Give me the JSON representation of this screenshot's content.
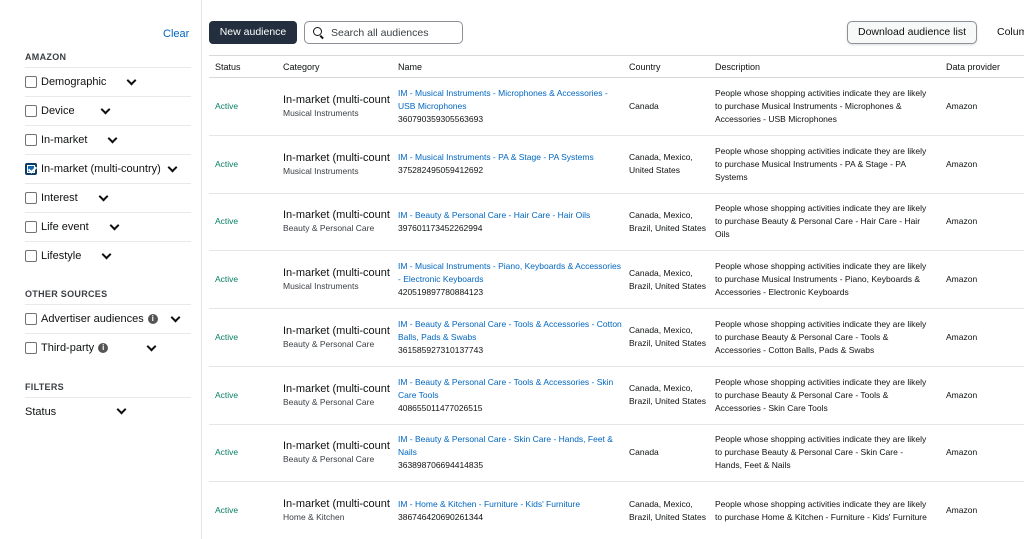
{
  "sidebar": {
    "clear_label": "Clear",
    "amazon_title": "AMAZON",
    "amazon_items": [
      {
        "label": "Demographic",
        "checked": false
      },
      {
        "label": "Device",
        "checked": false
      },
      {
        "label": "In-market",
        "checked": false
      },
      {
        "label": "In-market (multi-country)",
        "checked": true
      },
      {
        "label": "Interest",
        "checked": false
      },
      {
        "label": "Life event",
        "checked": false
      },
      {
        "label": "Lifestyle",
        "checked": false
      }
    ],
    "other_title": "OTHER SOURCES",
    "other_items": [
      {
        "label": "Advertiser audiences",
        "checked": false
      },
      {
        "label": "Third-party",
        "checked": false
      }
    ],
    "filters_title": "FILTERS",
    "status_label": "Status"
  },
  "toolbar": {
    "new_audience_label": "New audience",
    "search_placeholder": "Search all audiences",
    "download_label": "Download audience list",
    "columns_label": "Colum"
  },
  "table": {
    "headers": {
      "status": "Status",
      "category": "Category",
      "name": "Name",
      "country": "Country",
      "description": "Description",
      "provider": "Data provider"
    },
    "rows": [
      {
        "status": "Active",
        "category": "In-market (multi-count",
        "subcategory": "Musical Instruments",
        "name": "IM - Musical Instruments - Microphones & Accessories - USB Microphones",
        "id": "360790359305563693",
        "country": "Canada",
        "description": "People whose shopping activities indicate they are likely to purchase Musical Instruments - Microphones & Accessories - USB Microphones",
        "provider": "Amazon"
      },
      {
        "status": "Active",
        "category": "In-market (multi-count",
        "subcategory": "Musical Instruments",
        "name": "IM - Musical Instruments - PA & Stage - PA Systems",
        "id": "375282495059412692",
        "country": "Canada, Mexico, United States",
        "description": "People whose shopping activities indicate they are likely to purchase Musical Instruments - PA & Stage - PA Systems",
        "provider": "Amazon"
      },
      {
        "status": "Active",
        "category": "In-market (multi-count",
        "subcategory": "Beauty & Personal Care",
        "name": "IM - Beauty & Personal Care - Hair Care - Hair Oils",
        "id": "397601173452262994",
        "country": "Canada, Mexico, Brazil, United States",
        "description": "People whose shopping activities indicate they are likely to purchase Beauty & Personal Care - Hair Care - Hair Oils",
        "provider": "Amazon"
      },
      {
        "status": "Active",
        "category": "In-market (multi-count",
        "subcategory": "Musical Instruments",
        "name": "IM - Musical Instruments - Piano, Keyboards & Accessories - Electronic Keyboards",
        "id": "420519897780884123",
        "country": "Canada, Mexico, Brazil, United States",
        "description": "People whose shopping activities indicate they are likely to purchase Musical Instruments - Piano, Keyboards & Accessories - Electronic Keyboards",
        "provider": "Amazon"
      },
      {
        "status": "Active",
        "category": "In-market (multi-count",
        "subcategory": "Beauty & Personal Care",
        "name": "IM - Beauty & Personal Care - Tools & Accessories - Cotton Balls, Pads & Swabs",
        "id": "361585927310137743",
        "country": "Canada, Mexico, Brazil, United States",
        "description": "People whose shopping activities indicate they are likely to purchase Beauty & Personal Care - Tools & Accessories - Cotton Balls, Pads & Swabs",
        "provider": "Amazon"
      },
      {
        "status": "Active",
        "category": "In-market (multi-count",
        "subcategory": "Beauty & Personal Care",
        "name": "IM - Beauty & Personal Care - Tools & Accessories - Skin Care Tools",
        "id": "408655011477026515",
        "country": "Canada, Mexico, Brazil, United States",
        "description": "People whose shopping activities indicate they are likely to purchase Beauty & Personal Care - Tools & Accessories - Skin Care Tools",
        "provider": "Amazon"
      },
      {
        "status": "Active",
        "category": "In-market (multi-count",
        "subcategory": "Beauty & Personal Care",
        "name": "IM - Beauty & Personal Care - Skin Care - Hands, Feet & Nails",
        "id": "363898706694414835",
        "country": "Canada",
        "description": "People whose shopping activities indicate they are likely to purchase Beauty & Personal Care - Skin Care - Hands, Feet & Nails",
        "provider": "Amazon"
      },
      {
        "status": "Active",
        "category": "In-market (multi-count",
        "subcategory": "Home & Kitchen",
        "name": "IM - Home & Kitchen - Furniture - Kids' Furniture",
        "id": "386746420690261344",
        "country": "Canada, Mexico, Brazil, United States",
        "description": "People whose shopping activities indicate they are likely to purchase Home & Kitchen - Furniture - Kids' Furniture",
        "provider": "Amazon"
      }
    ]
  },
  "colors": {
    "link": "#0066c0",
    "active_status": "#067d62",
    "primary_button": "#232f3e",
    "checked_box": "#0f68b1"
  }
}
